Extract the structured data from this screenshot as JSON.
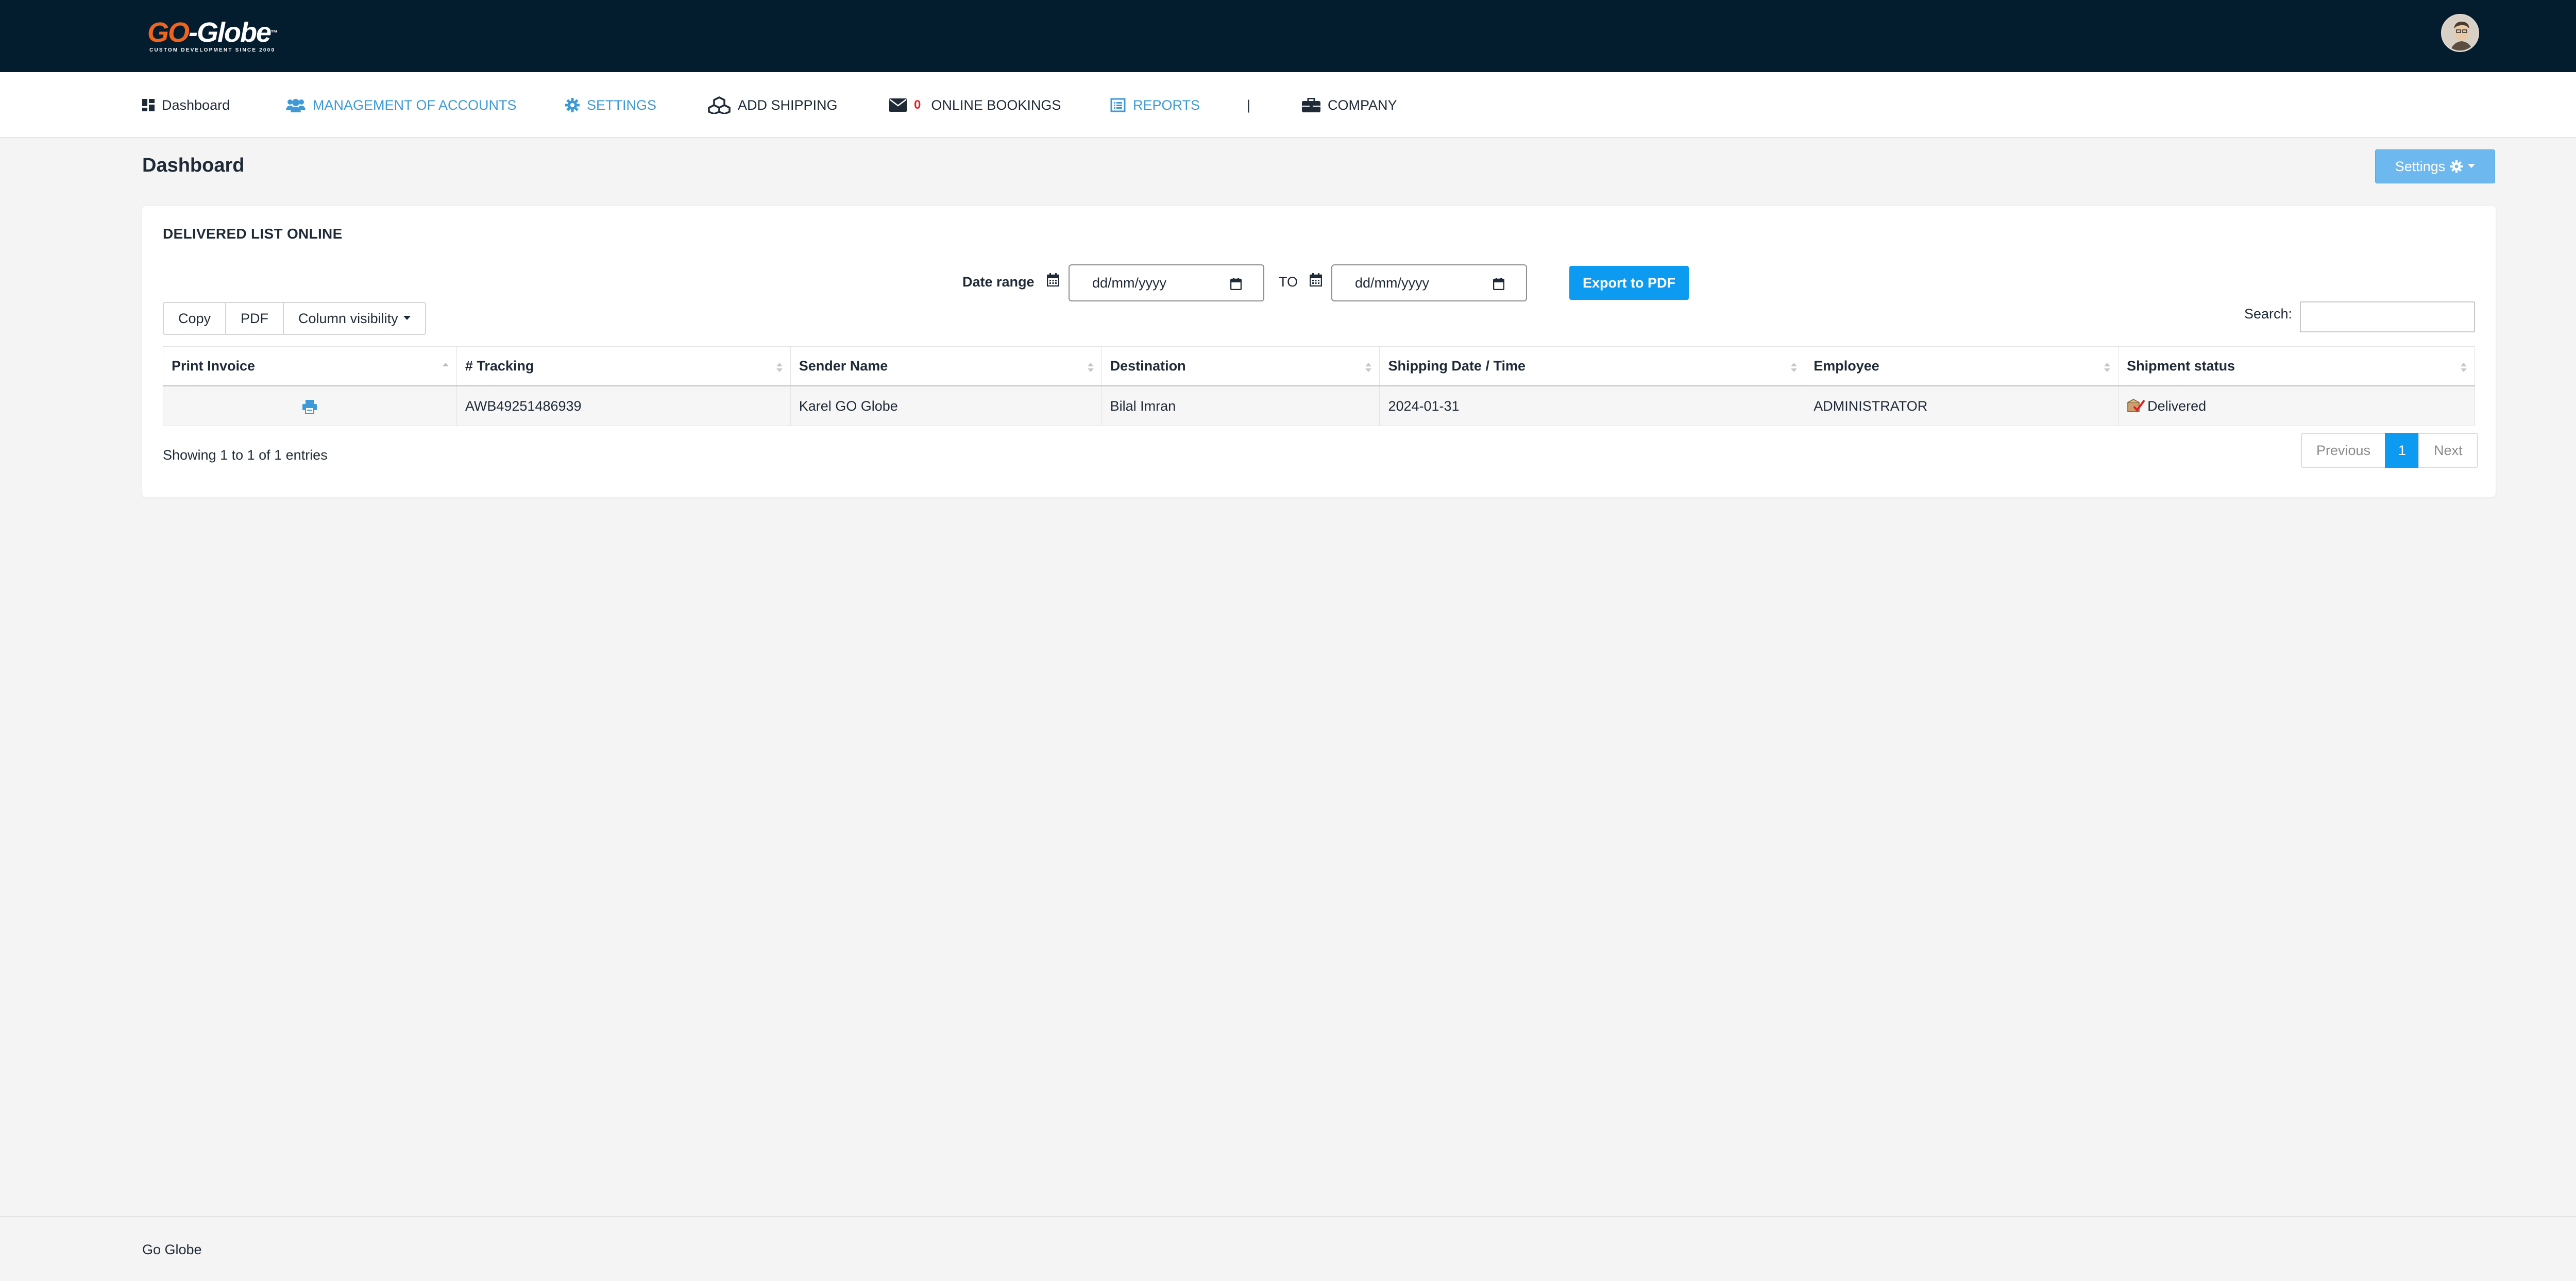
{
  "header": {
    "logo_text_accent": "GO",
    "logo_text_main": "-Globe",
    "logo_tagline": "CUSTOM DEVELOPMENT SINCE 2000",
    "avatar_icon": "user-avatar"
  },
  "nav": {
    "items": [
      {
        "label": "Dashboard",
        "icon": "dashboard-icon"
      },
      {
        "label": "MANAGEMENT OF ACCOUNTS",
        "icon": "users-icon"
      },
      {
        "label": "SETTINGS",
        "icon": "gear-icon"
      },
      {
        "label": "ADD SHIPPING",
        "icon": "cubes-icon"
      },
      {
        "label": "ONLINE BOOKINGS",
        "icon": "envelope-icon",
        "badge": "0"
      },
      {
        "label": "REPORTS",
        "icon": "list-alt-icon"
      },
      {
        "label": "COMPANY",
        "icon": "briefcase-icon"
      }
    ],
    "separator": "|"
  },
  "page": {
    "title": "Dashboard",
    "settings_button": "Settings"
  },
  "card": {
    "title": "DELIVERED LIST ONLINE",
    "date_range_label": "Date range",
    "date_from_placeholder": "dd/mm/yyyy",
    "to_label": "TO",
    "date_to_placeholder": "dd/mm/yyyy",
    "export_button": "Export to PDF",
    "buttons": {
      "copy": "Copy",
      "pdf": "PDF",
      "column_visibility": "Column visibility"
    },
    "search_label": "Search:",
    "search_value": ""
  },
  "table": {
    "columns": [
      "Print Invoice",
      "# Tracking",
      "Sender Name",
      "Destination",
      "Shipping Date / Time",
      "Employee",
      "Shipment status"
    ],
    "rows": [
      {
        "print_icon": "printer-icon",
        "tracking": "AWB49251486939",
        "sender": "Karel GO Globe",
        "destination": "Bilal Imran",
        "date": "2024-01-31",
        "employee": "ADMINISTRATOR",
        "status": "Delivered",
        "status_icon": "delivered-icon"
      }
    ]
  },
  "pagination": {
    "info": "Showing 1 to 1 of 1 entries",
    "previous": "Previous",
    "current": "1",
    "next": "Next"
  },
  "footer": {
    "text": "Go Globe"
  },
  "colors": {
    "topbar": "#041d2e",
    "accent_blue": "#0d9bf1",
    "nav_link_blue": "#3d9ad6",
    "logo_orange": "#f0641e"
  }
}
